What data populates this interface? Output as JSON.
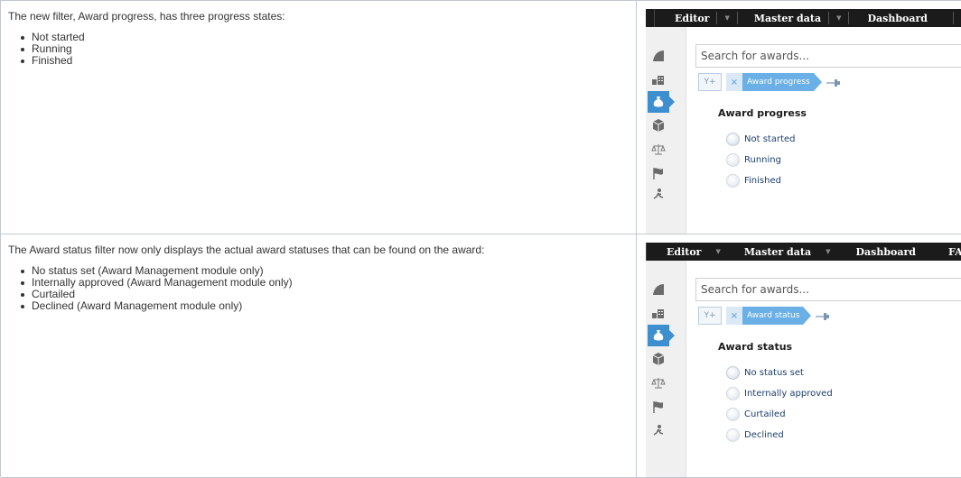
{
  "rows": [
    {
      "intro": "The new filter, Award progress, has three progress states:",
      "bullets": [
        "Not started",
        "Running",
        "Finished"
      ],
      "app": {
        "nav": [
          "Editor",
          "Master data",
          "Dashboard",
          ""
        ],
        "search_placeholder": "Search for awards...",
        "chip_label": "Award progress",
        "filter_title": "Award progress",
        "options": [
          "Not started",
          "Running",
          "Finished"
        ]
      }
    },
    {
      "intro": "The Award status filter now only displays the actual award statuses that can be found on the award:",
      "bullets": [
        "No status set (Award Management module only)",
        "Internally approved (Award Management module only)",
        "Curtailed",
        "Declined (Award Management module only)"
      ],
      "app": {
        "nav": [
          "Editor",
          "Master data",
          "Dashboard",
          "FA"
        ],
        "search_placeholder": "Search for awards...",
        "chip_label": "Award status",
        "filter_title": "Award status",
        "options": [
          "No status set",
          "Internally approved",
          "Curtailed",
          "Declined"
        ]
      }
    }
  ],
  "colors": {
    "nav_bg": "#1b1b1b",
    "accent": "#3d8fd0",
    "chip": "#6ab0e6",
    "option_text": "#1c3f6e",
    "border": "#c1c7d0"
  },
  "icons": {
    "sidebar": [
      "leaf-icon",
      "buildings-icon",
      "money-bag-icon",
      "box-icon",
      "scales-icon",
      "flag-icon",
      "runner-icon"
    ],
    "filter_add": "filter-add-icon",
    "chip_remove": "close-icon",
    "pin": "pin-icon"
  }
}
